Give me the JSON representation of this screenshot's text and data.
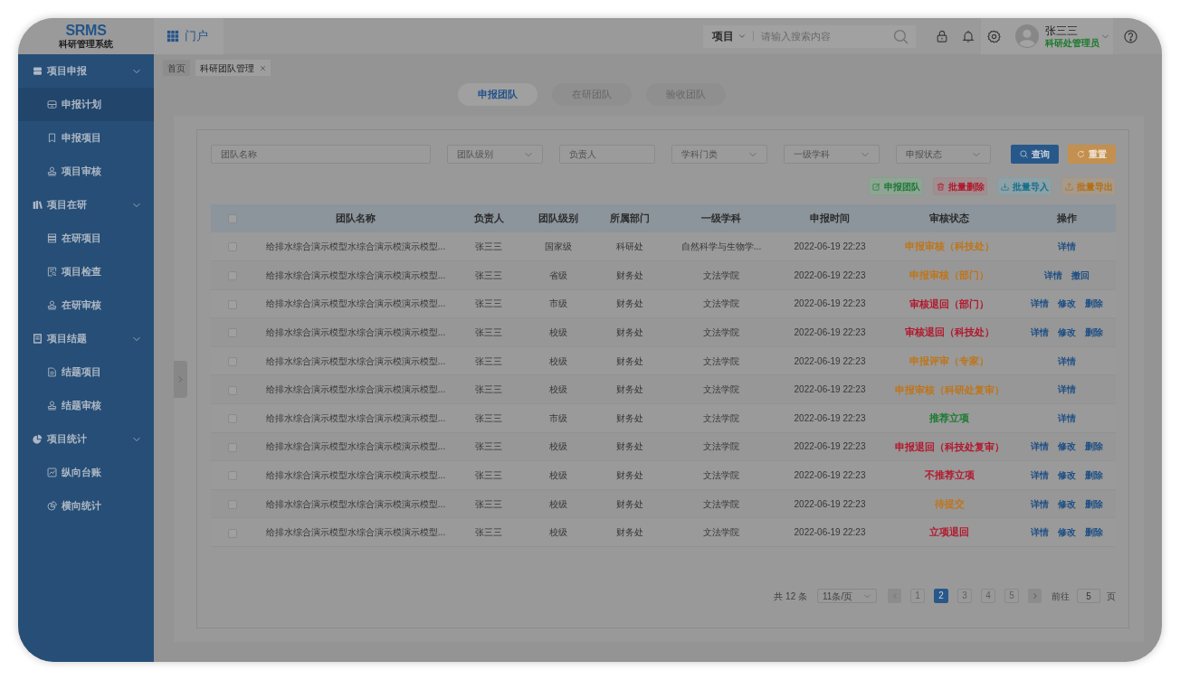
{
  "header": {
    "logo": "SRMS",
    "system_name": "科研管理系统",
    "portal": "门户",
    "search": {
      "scope": "项目",
      "placeholder": "请输入搜索内容"
    },
    "user": {
      "name": "张三三",
      "role": "科研处管理员"
    }
  },
  "sidebar": [
    {
      "label": "项目申报",
      "expanded": true,
      "children": [
        {
          "label": "申报计划",
          "selected": true
        },
        {
          "label": "申报项目",
          "selected": false
        },
        {
          "label": "项目审核",
          "selected": false
        }
      ]
    },
    {
      "label": "项目在研",
      "expanded": true,
      "children": [
        {
          "label": "在研项目",
          "selected": false
        },
        {
          "label": "项目检查",
          "selected": false
        },
        {
          "label": "在研审核",
          "selected": false
        }
      ]
    },
    {
      "label": "项目结题",
      "expanded": true,
      "children": [
        {
          "label": "结题项目",
          "selected": false
        },
        {
          "label": "结题审核",
          "selected": false
        }
      ]
    },
    {
      "label": "项目统计",
      "expanded": true,
      "children": [
        {
          "label": "纵向台账",
          "selected": false
        },
        {
          "label": "横向统计",
          "selected": false
        }
      ]
    }
  ],
  "open_tabs": [
    {
      "label": "首页",
      "selected": false,
      "closable": false
    },
    {
      "label": "科研团队管理",
      "selected": true,
      "closable": true
    }
  ],
  "tabs": [
    {
      "label": "申报团队",
      "selected": true
    },
    {
      "label": "在研团队",
      "selected": false
    },
    {
      "label": "验收团队",
      "selected": false
    }
  ],
  "filters": [
    {
      "kind": "input",
      "placeholder": "团队名称"
    },
    {
      "kind": "select",
      "placeholder": "团队级别"
    },
    {
      "kind": "input",
      "placeholder": "负责人"
    },
    {
      "kind": "select",
      "placeholder": "学科门类"
    },
    {
      "kind": "select",
      "placeholder": "一级学科"
    },
    {
      "kind": "select",
      "placeholder": "申报状态"
    }
  ],
  "filter_buttons": [
    {
      "label": "查询",
      "kind": "primary"
    },
    {
      "label": "重置",
      "kind": "warning"
    }
  ],
  "toolbar": [
    {
      "label": "申报团队",
      "kind": "success"
    },
    {
      "label": "批量删除",
      "kind": "danger"
    },
    {
      "label": "批量导入",
      "kind": "info"
    },
    {
      "label": "批量导出",
      "kind": "warning"
    }
  ],
  "table": {
    "all_checked": false,
    "columns": [
      "团队名称",
      "负责人",
      "团队级别",
      "所属部门",
      "一级学科",
      "申报时间",
      "审核状态",
      "操作"
    ],
    "rows": [
      {
        "checked": false,
        "name": "给排水综合演示模型水综合演示模演示模型...",
        "leader": "张三三",
        "level": "国家级",
        "department": "科研处",
        "discipline": "自然科学与生物学...",
        "time": "2022-06-19 22:23",
        "status": {
          "text": "申报审核（科技处）",
          "color": "#bf7519"
        },
        "actions": [
          "详情"
        ]
      },
      {
        "checked": false,
        "name": "给排水综合演示模型水综合演示模演示模型...",
        "leader": "张三三",
        "level": "省级",
        "department": "财务处",
        "discipline": "文法学院",
        "time": "2022-06-19 22:23",
        "status": {
          "text": "申报审核（部门）",
          "color": "#bf7519"
        },
        "actions": [
          "详情",
          "撤回"
        ]
      },
      {
        "checked": false,
        "name": "给排水综合演示模型水综合演示模演示模型...",
        "leader": "张三三",
        "level": "市级",
        "department": "财务处",
        "discipline": "文法学院",
        "time": "2022-06-19 22:23",
        "status": {
          "text": "审核退回（部门）",
          "color": "#b3172d"
        },
        "actions": [
          "详情",
          "修改",
          "删除"
        ]
      },
      {
        "checked": false,
        "name": "给排水综合演示模型水综合演示模演示模型...",
        "leader": "张三三",
        "level": "校级",
        "department": "财务处",
        "discipline": "文法学院",
        "time": "2022-06-19 22:23",
        "status": {
          "text": "审核退回（科技处）",
          "color": "#b3172d"
        },
        "actions": [
          "详情",
          "修改",
          "删除"
        ]
      },
      {
        "checked": false,
        "name": "给排水综合演示模型水综合演示模演示模型...",
        "leader": "张三三",
        "level": "校级",
        "department": "财务处",
        "discipline": "文法学院",
        "time": "2022-06-19 22:23",
        "status": {
          "text": "申报评审（专家）",
          "color": "#bf7519"
        },
        "actions": [
          "详情"
        ]
      },
      {
        "checked": false,
        "name": "给排水综合演示模型水综合演示模演示模型...",
        "leader": "张三三",
        "level": "校级",
        "department": "财务处",
        "discipline": "文法学院",
        "time": "2022-06-19 22:23",
        "status": {
          "text": "申报审核（科研处复审）",
          "color": "#bf7519"
        },
        "actions": [
          "详情"
        ]
      },
      {
        "checked": false,
        "name": "给排水综合演示模型水综合演示模演示模型...",
        "leader": "张三三",
        "level": "市级",
        "department": "财务处",
        "discipline": "文法学院",
        "time": "2022-06-19 22:23",
        "status": {
          "text": "推荐立项",
          "color": "#1a7a30"
        },
        "actions": [
          "详情"
        ]
      },
      {
        "checked": false,
        "name": "给排水综合演示模型水综合演示模演示模型...",
        "leader": "张三三",
        "level": "校级",
        "department": "财务处",
        "discipline": "文法学院",
        "time": "2022-06-19 22:23",
        "status": {
          "text": "申报退回（科技处复审）",
          "color": "#b3172d"
        },
        "actions": [
          "详情",
          "修改",
          "删除"
        ]
      },
      {
        "checked": false,
        "name": "给排水综合演示模型水综合演示模演示模型...",
        "leader": "张三三",
        "level": "校级",
        "department": "财务处",
        "discipline": "文法学院",
        "time": "2022-06-19 22:23",
        "status": {
          "text": "不推荐立项",
          "color": "#b3172d"
        },
        "actions": [
          "详情",
          "修改",
          "删除"
        ]
      },
      {
        "checked": false,
        "name": "给排水综合演示模型水综合演示模演示模型...",
        "leader": "张三三",
        "level": "校级",
        "department": "财务处",
        "discipline": "文法学院",
        "time": "2022-06-19 22:23",
        "status": {
          "text": "待提交",
          "color": "#bf7519"
        },
        "actions": [
          "详情",
          "修改",
          "删除"
        ]
      },
      {
        "checked": false,
        "name": "给排水综合演示模型水综合演示模演示模型...",
        "leader": "张三三",
        "level": "校级",
        "department": "财务处",
        "discipline": "文法学院",
        "time": "2022-06-19 22:23",
        "status": {
          "text": "立项退回",
          "color": "#b3172d"
        },
        "actions": [
          "详情",
          "修改",
          "删除"
        ]
      }
    ]
  },
  "pagination": {
    "total": "共 12 条",
    "page_size": "11条/页",
    "prev": {
      "disabled": true
    },
    "pages": [
      {
        "label": "1",
        "selected": false
      },
      {
        "label": "2",
        "selected": true
      },
      {
        "label": "3",
        "selected": false
      },
      {
        "label": "4",
        "selected": false
      },
      {
        "label": "5",
        "selected": false
      }
    ],
    "next": {
      "disabled": false
    },
    "goto_label": "前往",
    "goto_value": "5",
    "goto_suffix": "页"
  }
}
